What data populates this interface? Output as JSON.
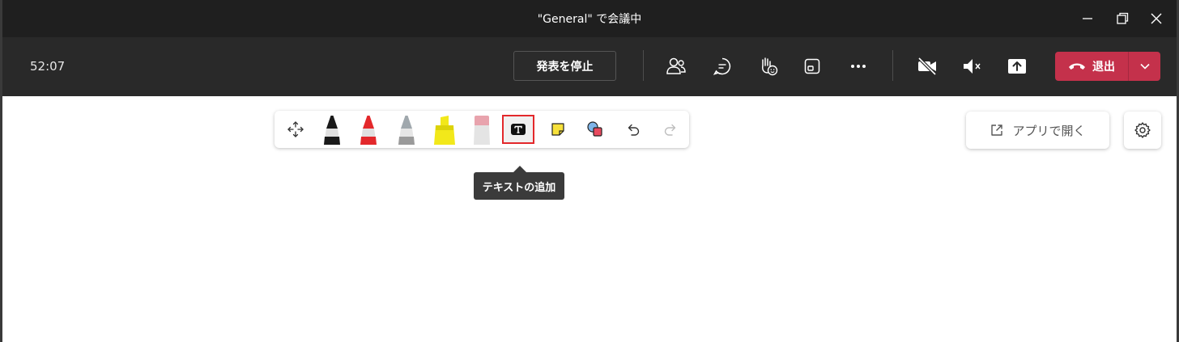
{
  "window": {
    "title": "\"General\" で会議中"
  },
  "meeting_bar": {
    "timer": "52:07",
    "stop_presenting_label": "発表を停止",
    "leave_label": "退出"
  },
  "whiteboard": {
    "tools": [
      {
        "name": "move",
        "icon": "move-icon"
      },
      {
        "name": "black-pen",
        "icon": "pen-icon",
        "color": "#1a1a1a"
      },
      {
        "name": "red-pen",
        "icon": "pen-icon",
        "color": "#e3282b"
      },
      {
        "name": "silver-pen",
        "icon": "pen-icon",
        "color": "#9a9a9a"
      },
      {
        "name": "highlighter",
        "icon": "highlighter-icon",
        "color": "#f2e81a"
      },
      {
        "name": "eraser",
        "icon": "eraser-icon",
        "color": "#e8a3ad"
      },
      {
        "name": "add-text",
        "icon": "text-icon",
        "selected": true
      },
      {
        "name": "sticky-note",
        "icon": "note-icon",
        "color": "#f7e13b"
      },
      {
        "name": "shapes",
        "icon": "shapes-icon"
      },
      {
        "name": "undo",
        "icon": "undo-icon"
      },
      {
        "name": "redo",
        "icon": "redo-icon"
      }
    ],
    "tooltip": "テキストの追加",
    "open_in_app_label": "アプリで開く"
  },
  "colors": {
    "titlebar": "#1f1f1f",
    "meetingbar": "#292929",
    "leave_button": "#c4314b",
    "selection_border": "#e3282b"
  }
}
